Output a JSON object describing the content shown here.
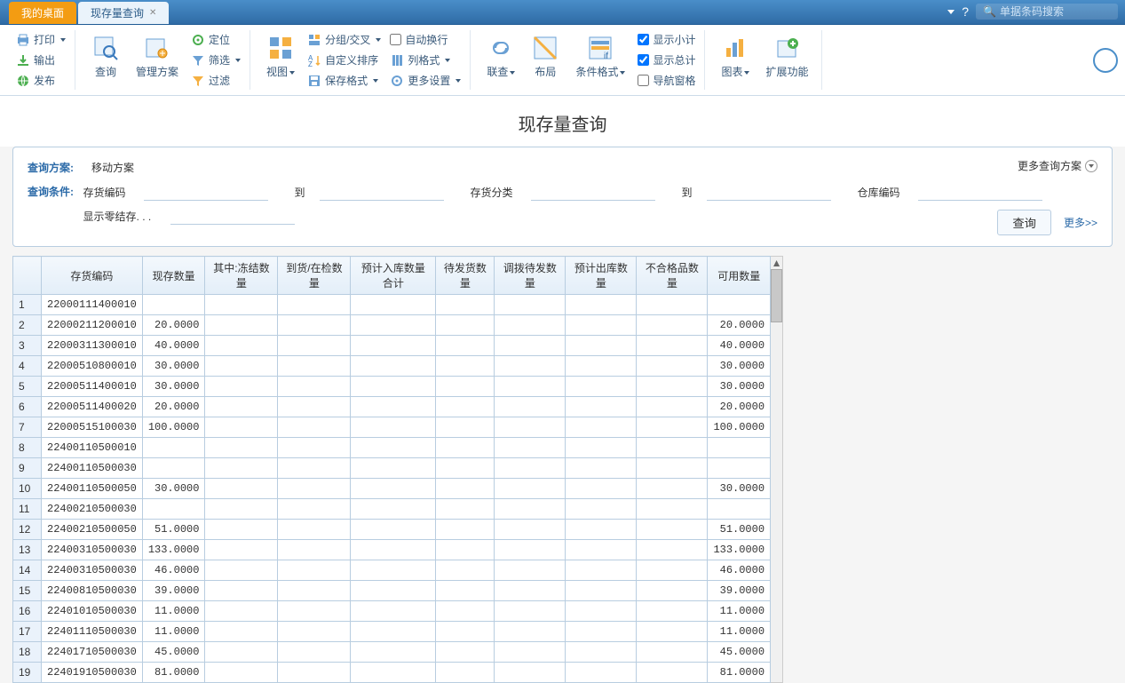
{
  "tabs": {
    "t0": "我的桌面",
    "t1": "现存量查询"
  },
  "search": {
    "placeholder": "单据条码搜索"
  },
  "ribbon": {
    "print": "打印",
    "export": "输出",
    "publish": "发布",
    "query": "查询",
    "plan": "管理方案",
    "locate": "定位",
    "filter": "筛选",
    "filter2": "过滤",
    "view": "视图",
    "group": "分组/交叉",
    "sort": "自定义排序",
    "savefmt": "保存格式",
    "autowrap": "自动换行",
    "colfmt": "列格式",
    "moreset": "更多设置",
    "link": "联查",
    "layout": "布局",
    "condfmt": "条件格式",
    "subtotal": "显示小计",
    "total": "显示总计",
    "navpane": "导航窗格",
    "chart": "图表",
    "ext": "扩展功能"
  },
  "pageTitle": "现存量查询",
  "panel": {
    "planLabel": "查询方案:",
    "planValue": "移动方案",
    "moreLabel": "更多查询方案",
    "condLabel": "查询条件:",
    "f_invcode": "存货编码",
    "f_to": "到",
    "f_invclass": "存货分类",
    "f_whcode": "仓库编码",
    "f_zero": "显示零结存. . .",
    "btnQuery": "查询",
    "linkMore": "更多>>"
  },
  "grid": {
    "cols": {
      "code": "存货编码",
      "qty": "现存数量",
      "frozen": "其中:冻结数量",
      "arr": "到货/在检数量",
      "plin": "预计入库数量合计",
      "ship": "待发货数量",
      "alloc": "调拨待发数量",
      "plout": "预计出库数量",
      "ng": "不合格品数量",
      "avail": "可用数量"
    },
    "rows": [
      {
        "n": "1",
        "code": "22000111400010",
        "qty": "",
        "avail": ""
      },
      {
        "n": "2",
        "code": "22000211200010",
        "qty": "20.0000",
        "avail": "20.0000"
      },
      {
        "n": "3",
        "code": "22000311300010",
        "qty": "40.0000",
        "avail": "40.0000"
      },
      {
        "n": "4",
        "code": "22000510800010",
        "qty": "30.0000",
        "avail": "30.0000"
      },
      {
        "n": "5",
        "code": "22000511400010",
        "qty": "30.0000",
        "avail": "30.0000"
      },
      {
        "n": "6",
        "code": "22000511400020",
        "qty": "20.0000",
        "avail": "20.0000"
      },
      {
        "n": "7",
        "code": "22000515100030",
        "qty": "100.0000",
        "avail": "100.0000"
      },
      {
        "n": "8",
        "code": "22400110500010",
        "qty": "",
        "avail": ""
      },
      {
        "n": "9",
        "code": "22400110500030",
        "qty": "",
        "avail": ""
      },
      {
        "n": "10",
        "code": "22400110500050",
        "qty": "30.0000",
        "avail": "30.0000"
      },
      {
        "n": "11",
        "code": "22400210500030",
        "qty": "",
        "avail": ""
      },
      {
        "n": "12",
        "code": "22400210500050",
        "qty": "51.0000",
        "avail": "51.0000"
      },
      {
        "n": "13",
        "code": "22400310500030",
        "qty": "133.0000",
        "avail": "133.0000"
      },
      {
        "n": "14",
        "code": "22400310500030",
        "qty": "46.0000",
        "avail": "46.0000"
      },
      {
        "n": "15",
        "code": "22400810500030",
        "qty": "39.0000",
        "avail": "39.0000"
      },
      {
        "n": "16",
        "code": "22401010500030",
        "qty": "11.0000",
        "avail": "11.0000"
      },
      {
        "n": "17",
        "code": "22401110500030",
        "qty": "11.0000",
        "avail": "11.0000"
      },
      {
        "n": "18",
        "code": "22401710500030",
        "qty": "45.0000",
        "avail": "45.0000"
      },
      {
        "n": "19",
        "code": "22401910500030",
        "qty": "81.0000",
        "avail": "81.0000"
      }
    ]
  }
}
